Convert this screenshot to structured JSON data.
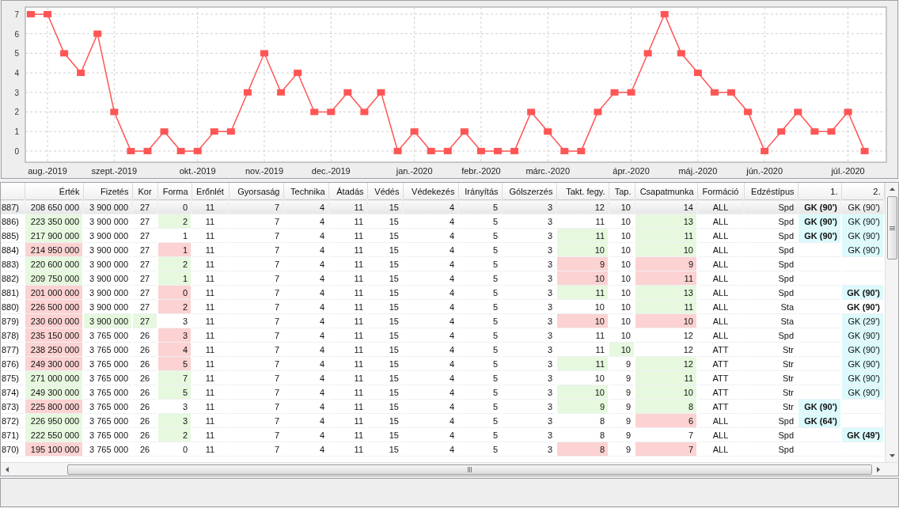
{
  "chart": {
    "chart_data": {
      "type": "line",
      "categories": [
        null,
        "aug.-2019",
        null,
        null,
        null,
        "szept.-2019",
        null,
        null,
        null,
        null,
        "okt.-2019",
        null,
        null,
        null,
        "nov.-2019",
        null,
        null,
        null,
        "dec.-2019",
        null,
        null,
        null,
        null,
        "jan.-2020",
        null,
        null,
        null,
        "febr.-2020",
        null,
        null,
        null,
        "márc.-2020",
        null,
        null,
        null,
        null,
        "ápr.-2020",
        null,
        null,
        null,
        "máj.-2020",
        null,
        null,
        null,
        "jún.-2020",
        null,
        null,
        null,
        null,
        "júl.-2020",
        null
      ],
      "grid": true,
      "series": [
        {
          "color": "#ff5555",
          "marker": "square",
          "values": [
            7,
            7,
            5,
            4,
            6,
            2,
            0,
            0,
            1,
            0,
            0,
            1,
            1,
            3,
            5,
            3,
            4,
            2,
            2,
            3,
            2,
            3,
            0,
            1,
            0,
            0,
            1,
            0,
            0,
            0,
            2,
            1,
            0,
            0,
            2,
            3,
            3,
            5,
            7,
            5,
            4,
            3,
            3,
            2,
            0,
            1,
            2,
            1,
            1,
            2,
            0
          ]
        }
      ],
      "ylim": [
        -0.57,
        7.36
      ],
      "yticks": [
        0,
        1,
        2,
        3,
        4,
        5,
        6,
        7
      ]
    }
  },
  "table": {
    "columns": [
      "",
      "Érték",
      "Fizetés",
      "Kor",
      "Forma",
      "Erőnlét",
      "Gyorsaság",
      "Technika",
      "Átadás",
      "Védés",
      "Védekezés",
      "Irányítás",
      "Gólszerzés",
      "Takt. fegy.",
      "Tap.",
      "Csapatmunka",
      "Formáció",
      "Edzéstípus",
      "1.",
      "2."
    ],
    "rows": [
      {
        "selected": true,
        "cells": [
          "887)",
          "208 650 000",
          "3 900 000",
          "27",
          "0",
          "11",
          "7",
          "4",
          "11",
          "15",
          "4",
          "5",
          "3",
          "12",
          "10",
          "14",
          "ALL",
          "Spd",
          {
            "text": "GK (90')",
            "bold": true
          },
          "GK (90')"
        ]
      },
      {
        "selected": false,
        "cells": [
          "886)",
          {
            "text": "223 350 000",
            "color": "#e6f8de"
          },
          "3 900 000",
          "27",
          {
            "text": "2",
            "color": "#e6f8de"
          },
          "11",
          "7",
          "4",
          "11",
          "15",
          "4",
          "5",
          "3",
          "11",
          "10",
          {
            "text": "13",
            "color": "#e6f8de"
          },
          "ALL",
          "Spd",
          {
            "text": "GK (90')",
            "color": "#dcfafc",
            "bold": true
          },
          {
            "text": "GK (90')",
            "color": "#dcfafc"
          }
        ]
      },
      {
        "selected": false,
        "cells": [
          "885)",
          {
            "text": "217 900 000",
            "color": "#e6f8de"
          },
          "3 900 000",
          "27",
          "1",
          "11",
          "7",
          "4",
          "11",
          "15",
          "4",
          "5",
          "3",
          {
            "text": "11",
            "color": "#e6f8de"
          },
          "10",
          {
            "text": "11",
            "color": "#e6f8de"
          },
          "ALL",
          "Spd",
          {
            "text": "GK (90')",
            "color": "#dcfafc",
            "bold": true
          },
          {
            "text": "GK (90')",
            "color": "#dcfafc"
          }
        ]
      },
      {
        "selected": false,
        "cells": [
          "884)",
          {
            "text": "214 950 000",
            "color": "#fcd2d2"
          },
          "3 900 000",
          "27",
          {
            "text": "1",
            "color": "#fcd2d2"
          },
          "11",
          "7",
          "4",
          "11",
          "15",
          "4",
          "5",
          "3",
          {
            "text": "10",
            "color": "#e6f8de"
          },
          "10",
          {
            "text": "10",
            "color": "#e6f8de"
          },
          "ALL",
          "Spd",
          "",
          {
            "text": "GK (90')",
            "color": "#dcfafc"
          }
        ]
      },
      {
        "selected": false,
        "cells": [
          "883)",
          {
            "text": "220 600 000",
            "color": "#e6f8de"
          },
          "3 900 000",
          "27",
          {
            "text": "2",
            "color": "#e6f8de"
          },
          "11",
          "7",
          "4",
          "11",
          "15",
          "4",
          "5",
          "3",
          {
            "text": "9",
            "color": "#fcd2d2"
          },
          "10",
          {
            "text": "9",
            "color": "#fcd2d2"
          },
          "ALL",
          "Spd",
          "",
          ""
        ]
      },
      {
        "selected": false,
        "cells": [
          "882)",
          {
            "text": "209 750 000",
            "color": "#e6f8de"
          },
          "3 900 000",
          "27",
          {
            "text": "1",
            "color": "#e6f8de"
          },
          "11",
          "7",
          "4",
          "11",
          "15",
          "4",
          "5",
          "3",
          {
            "text": "10",
            "color": "#fcd2d2"
          },
          "10",
          {
            "text": "11",
            "color": "#fcd2d2"
          },
          "ALL",
          "Spd",
          "",
          ""
        ]
      },
      {
        "selected": false,
        "cells": [
          "881)",
          {
            "text": "201 000 000",
            "color": "#fcd2d2"
          },
          "3 900 000",
          "27",
          {
            "text": "0",
            "color": "#fcd2d2"
          },
          "11",
          "7",
          "4",
          "11",
          "15",
          "4",
          "5",
          "3",
          {
            "text": "11",
            "color": "#e6f8de"
          },
          "10",
          {
            "text": "13",
            "color": "#e6f8de"
          },
          "ALL",
          "Spd",
          "",
          {
            "text": "GK (90')",
            "color": "#dcfafc",
            "bold": true
          }
        ]
      },
      {
        "selected": false,
        "cells": [
          "880)",
          {
            "text": "226 500 000",
            "color": "#fcd2d2"
          },
          "3 900 000",
          "27",
          {
            "text": "2",
            "color": "#fcd2d2"
          },
          "11",
          "7",
          "4",
          "11",
          "15",
          "4",
          "5",
          "3",
          "10",
          "10",
          {
            "text": "11",
            "color": "#e6f8de"
          },
          "ALL",
          "Sta",
          "",
          {
            "text": "GK (90')",
            "bold": true
          }
        ]
      },
      {
        "selected": false,
        "cells": [
          "879)",
          {
            "text": "230 600 000",
            "color": "#fcd2d2"
          },
          {
            "text": "3 900 000",
            "color": "#e6f8de"
          },
          {
            "text": "27",
            "color": "#e6f8de"
          },
          "3",
          "11",
          "7",
          "4",
          "11",
          "15",
          "4",
          "5",
          "3",
          {
            "text": "10",
            "color": "#fcd2d2"
          },
          "10",
          {
            "text": "10",
            "color": "#fcd2d2"
          },
          "ALL",
          "Sta",
          "",
          {
            "text": "GK (29')",
            "color": "#dcfafc"
          }
        ]
      },
      {
        "selected": false,
        "cells": [
          "878)",
          {
            "text": "235 150 000",
            "color": "#fcd2d2"
          },
          "3 765 000",
          "26",
          {
            "text": "3",
            "color": "#fcd2d2"
          },
          "11",
          "7",
          "4",
          "11",
          "15",
          "4",
          "5",
          "3",
          "11",
          "10",
          "12",
          "ALL",
          "Spd",
          "",
          {
            "text": "GK (90')",
            "color": "#dcfafc"
          }
        ]
      },
      {
        "selected": false,
        "cells": [
          "877)",
          {
            "text": "238 250 000",
            "color": "#fcd2d2"
          },
          "3 765 000",
          "26",
          {
            "text": "4",
            "color": "#fcd2d2"
          },
          "11",
          "7",
          "4",
          "11",
          "15",
          "4",
          "5",
          "3",
          "11",
          {
            "text": "10",
            "color": "#e6f8de"
          },
          "12",
          "ATT",
          "Str",
          "",
          {
            "text": "GK (90')",
            "color": "#dcfafc"
          }
        ]
      },
      {
        "selected": false,
        "cells": [
          "876)",
          {
            "text": "249 300 000",
            "color": "#fcd2d2"
          },
          "3 765 000",
          "26",
          {
            "text": "5",
            "color": "#fcd2d2"
          },
          "11",
          "7",
          "4",
          "11",
          "15",
          "4",
          "5",
          "3",
          {
            "text": "11",
            "color": "#e6f8de"
          },
          "9",
          {
            "text": "12",
            "color": "#e6f8de"
          },
          "ATT",
          "Str",
          "",
          {
            "text": "GK (90')",
            "color": "#dcfafc"
          }
        ]
      },
      {
        "selected": false,
        "cells": [
          "875)",
          {
            "text": "271 000 000",
            "color": "#e6f8de"
          },
          "3 765 000",
          "26",
          {
            "text": "7",
            "color": "#e6f8de"
          },
          "11",
          "7",
          "4",
          "11",
          "15",
          "4",
          "5",
          "3",
          "10",
          "9",
          {
            "text": "11",
            "color": "#e6f8de"
          },
          "ATT",
          "Str",
          "",
          {
            "text": "GK (90')",
            "color": "#dcfafc"
          }
        ]
      },
      {
        "selected": false,
        "cells": [
          "874)",
          {
            "text": "249 300 000",
            "color": "#e6f8de"
          },
          "3 765 000",
          "26",
          {
            "text": "5",
            "color": "#e6f8de"
          },
          "11",
          "7",
          "4",
          "11",
          "15",
          "4",
          "5",
          "3",
          {
            "text": "10",
            "color": "#e6f8de"
          },
          "9",
          {
            "text": "10",
            "color": "#e6f8de"
          },
          "ATT",
          "Str",
          "",
          {
            "text": "GK (90')",
            "color": "#dcfafc"
          }
        ]
      },
      {
        "selected": false,
        "cells": [
          "873)",
          {
            "text": "225 800 000",
            "color": "#fcd2d2"
          },
          "3 765 000",
          "26",
          "3",
          "11",
          "7",
          "4",
          "11",
          "15",
          "4",
          "5",
          "3",
          {
            "text": "9",
            "color": "#e6f8de"
          },
          "9",
          {
            "text": "8",
            "color": "#e6f8de"
          },
          "ATT",
          "Str",
          {
            "text": "GK (90')",
            "color": "#dcfafc",
            "bold": true
          },
          ""
        ]
      },
      {
        "selected": false,
        "cells": [
          "872)",
          {
            "text": "226 950 000",
            "color": "#e6f8de"
          },
          "3 765 000",
          "26",
          {
            "text": "3",
            "color": "#e6f8de"
          },
          "11",
          "7",
          "4",
          "11",
          "15",
          "4",
          "5",
          "3",
          "8",
          "9",
          {
            "text": "6",
            "color": "#fcd2d2"
          },
          "ALL",
          "Spd",
          {
            "text": "GK (64')",
            "color": "#dcfafc",
            "bold": true
          },
          ""
        ]
      },
      {
        "selected": false,
        "cells": [
          "871)",
          {
            "text": "222 550 000",
            "color": "#e6f8de"
          },
          "3 765 000",
          "26",
          {
            "text": "2",
            "color": "#e6f8de"
          },
          "11",
          "7",
          "4",
          "11",
          "15",
          "4",
          "5",
          "3",
          "8",
          "9",
          "7",
          "ALL",
          "Spd",
          "",
          {
            "text": "GK (49')",
            "color": "#dcfafc",
            "bold": true
          }
        ]
      },
      {
        "selected": false,
        "cells": [
          "870)",
          {
            "text": "195 100 000",
            "color": "#fcd2d2"
          },
          "3 765 000",
          "26",
          "0",
          "11",
          "7",
          "4",
          "11",
          "15",
          "4",
          "5",
          "3",
          {
            "text": "8",
            "color": "#fcd2d2"
          },
          "9",
          {
            "text": "7",
            "color": "#fcd2d2"
          },
          "ALL",
          "Spd",
          "",
          ""
        ]
      }
    ]
  }
}
